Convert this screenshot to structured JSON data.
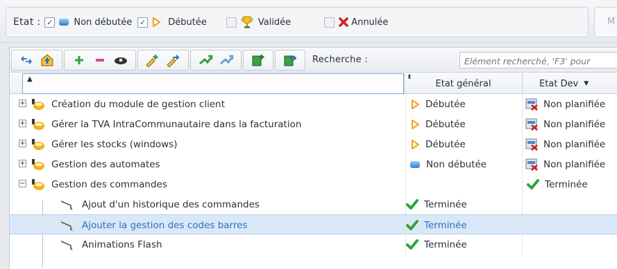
{
  "filter": {
    "label": "Etat :",
    "items": [
      {
        "label": "Non débutée",
        "checked": true,
        "icon": "not-started-icon"
      },
      {
        "label": "Débutée",
        "checked": true,
        "icon": "started-icon"
      },
      {
        "label": "Validée",
        "checked": false,
        "icon": "trophy-icon"
      },
      {
        "label": "Annulée",
        "checked": false,
        "icon": "cancel-x-icon"
      }
    ],
    "right_field_text": "M"
  },
  "toolbar": {
    "search_label": "Recherche :",
    "search_placeholder": "Elément recherché, 'F3' pour"
  },
  "grid": {
    "columns": [
      {
        "label": ""
      },
      {
        "label": "Etat général"
      },
      {
        "label": "Etat Dev"
      }
    ],
    "rows": [
      {
        "name": "Création du module de gestion client",
        "etat_general": "Débutée",
        "etat_dev": "Non planifiée",
        "expander": "+",
        "level": 0
      },
      {
        "name": "Gérer la TVA IntraCommunautaire dans la facturation",
        "etat_general": "Débutée",
        "etat_dev": "Non planifiée",
        "expander": "+",
        "level": 0
      },
      {
        "name": "Gérer les stocks (windows)",
        "etat_general": "Débutée",
        "etat_dev": "Non planifiée",
        "expander": "+",
        "level": 0
      },
      {
        "name": "Gestion des automates",
        "etat_general": "Non débutée",
        "etat_dev": "Non planifiée",
        "expander": "+",
        "level": 0
      },
      {
        "name": "Gestion des commandes",
        "etat_general": "",
        "etat_dev": "Terminée",
        "expander": "−",
        "level": 0
      },
      {
        "name": "Ajout d'un historique des commandes",
        "etat_general": "Terminée",
        "etat_dev": "",
        "expander": "",
        "level": 1
      },
      {
        "name": "Ajouter la gestion des codes barres",
        "etat_general": "Terminée",
        "etat_dev": "",
        "expander": "",
        "level": 1,
        "selected": true
      },
      {
        "name": "Animations Flash",
        "etat_general": "Terminée",
        "etat_dev": "",
        "expander": "",
        "level": 1
      }
    ]
  }
}
